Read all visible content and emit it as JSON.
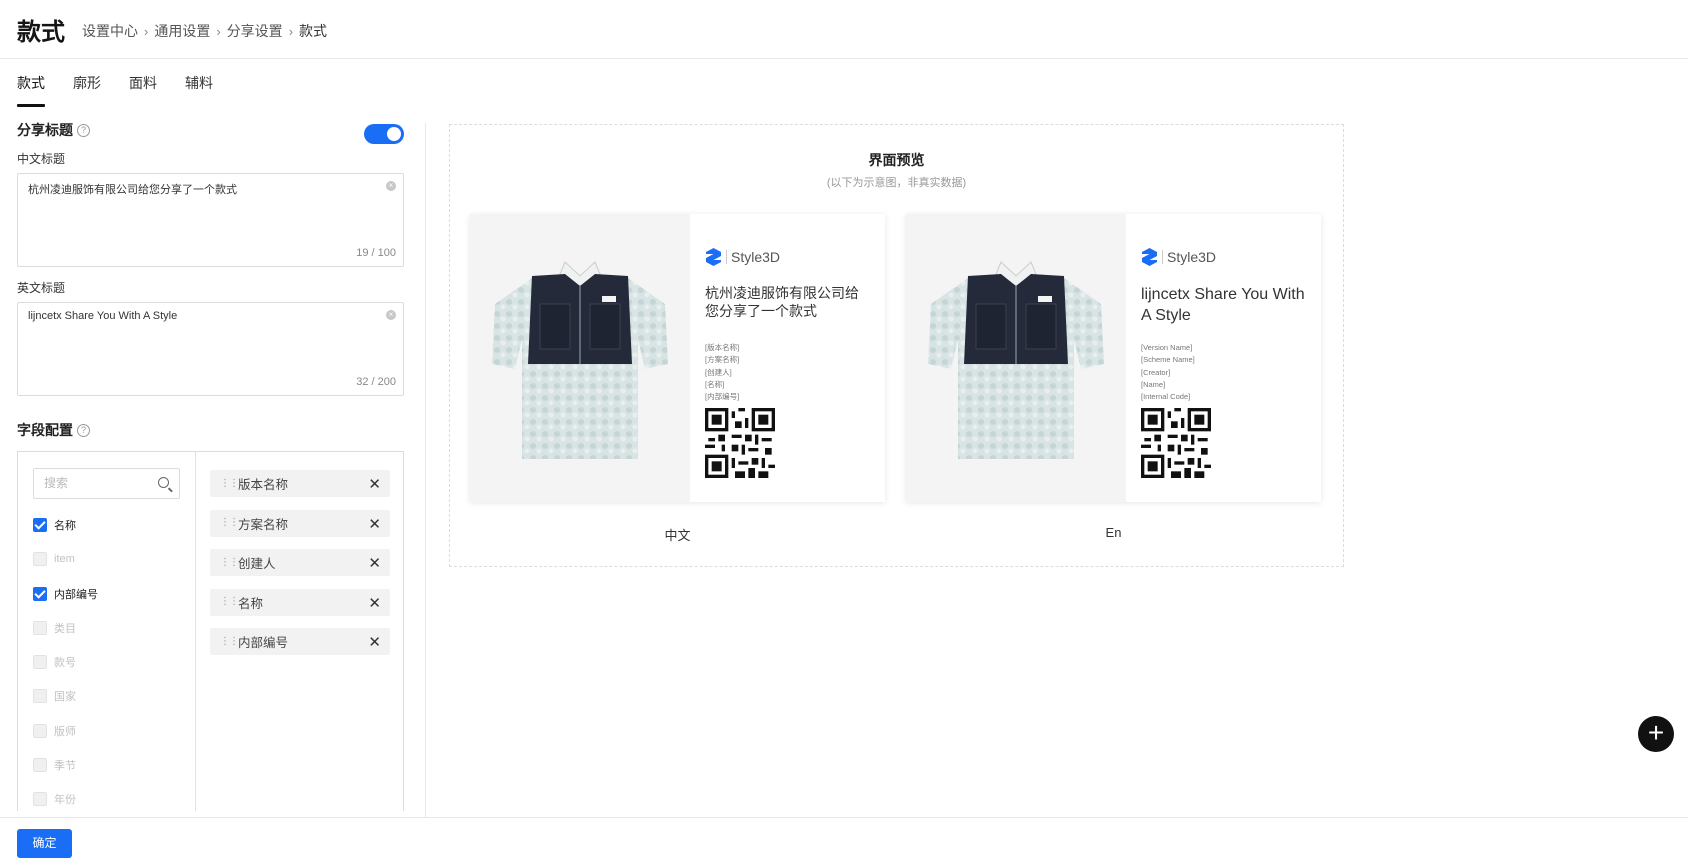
{
  "header": {
    "title": "款式",
    "breadcrumb": [
      "设置中心",
      "通用设置",
      "分享设置",
      "款式"
    ]
  },
  "tabs": [
    "款式",
    "廓形",
    "面料",
    "辅料"
  ],
  "share_title": {
    "label": "分享标题",
    "enabled": true,
    "cn_label": "中文标题",
    "cn_value": "杭州凌迪服饰有限公司给您分享了一个款式",
    "cn_count": "19 / 100",
    "en_label": "英文标题",
    "en_value": "lijncetx  Share You With A Style",
    "en_count": "32 / 200"
  },
  "field_config": {
    "label": "字段配置",
    "search_placeholder": "搜索",
    "options": [
      {
        "label": "名称",
        "checked": true,
        "enabled": true
      },
      {
        "label": "item",
        "checked": false,
        "enabled": false
      },
      {
        "label": "内部编号",
        "checked": true,
        "enabled": true
      },
      {
        "label": "类目",
        "checked": false,
        "enabled": false
      },
      {
        "label": "款号",
        "checked": false,
        "enabled": false
      },
      {
        "label": "国家",
        "checked": false,
        "enabled": false
      },
      {
        "label": "版师",
        "checked": false,
        "enabled": false
      },
      {
        "label": "季节",
        "checked": false,
        "enabled": false
      },
      {
        "label": "年份",
        "checked": false,
        "enabled": false
      }
    ],
    "selected": [
      "版本名称",
      "方案名称",
      "创建人",
      "名称",
      "内部编号"
    ]
  },
  "preview": {
    "title": "界面预览",
    "subtitle": "(以下为示意图，非真实数据)",
    "brand": "Style3D",
    "cards": [
      {
        "caption": "中文",
        "title": "杭州凌迪服饰有限公司给您分享了一个款式",
        "meta": [
          "[版本名称]",
          "[方案名称]",
          "[创建人]",
          "[名称]",
          "[内部编号]"
        ]
      },
      {
        "caption": "En",
        "title": "lijncetx  Share You With A Style",
        "meta": [
          "[Version Name]",
          "[Scheme Name]",
          "[Creator]",
          "[Name]",
          "[Internal Code]"
        ]
      }
    ]
  },
  "footer": {
    "confirm_label": "确定"
  },
  "colors": {
    "primary": "#1a6ef5",
    "fab": "#111111"
  },
  "icons": [
    "help-icon",
    "clear-icon",
    "search-icon",
    "drag-icon",
    "close-icon",
    "plus-icon",
    "style3d-logo-icon",
    "qr-code-icon"
  ]
}
